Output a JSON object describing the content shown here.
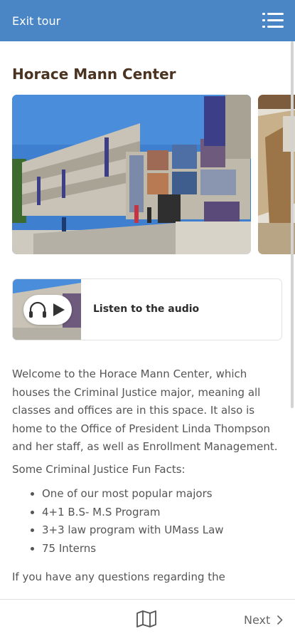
{
  "header": {
    "exit_label": "Exit tour",
    "menu_icon": "hamburger-menu-icon",
    "bg_color": "#4a86c5"
  },
  "stop": {
    "title": "Horace Mann Center",
    "audio": {
      "label": "Listen to the audio",
      "icon": "headphones-play-icon"
    },
    "intro": "Welcome to the Horace Mann Center, which houses the Criminal Justice major, meaning all classes and offices are in this space. It also is home to the Office of President Linda Thompson and her staff, as well as Enrollment Management.",
    "facts_heading": "Some Criminal Justice Fun Facts:",
    "facts": [
      "One of our most popular majors",
      "4+1 B.S- M.S Program",
      "3+3 law program with UMass Law",
      "75 Interns"
    ],
    "outro": "If you have any questions regarding the"
  },
  "footer": {
    "map_icon": "map-icon",
    "next_label": "Next",
    "next_icon": "chevron-right-icon"
  }
}
